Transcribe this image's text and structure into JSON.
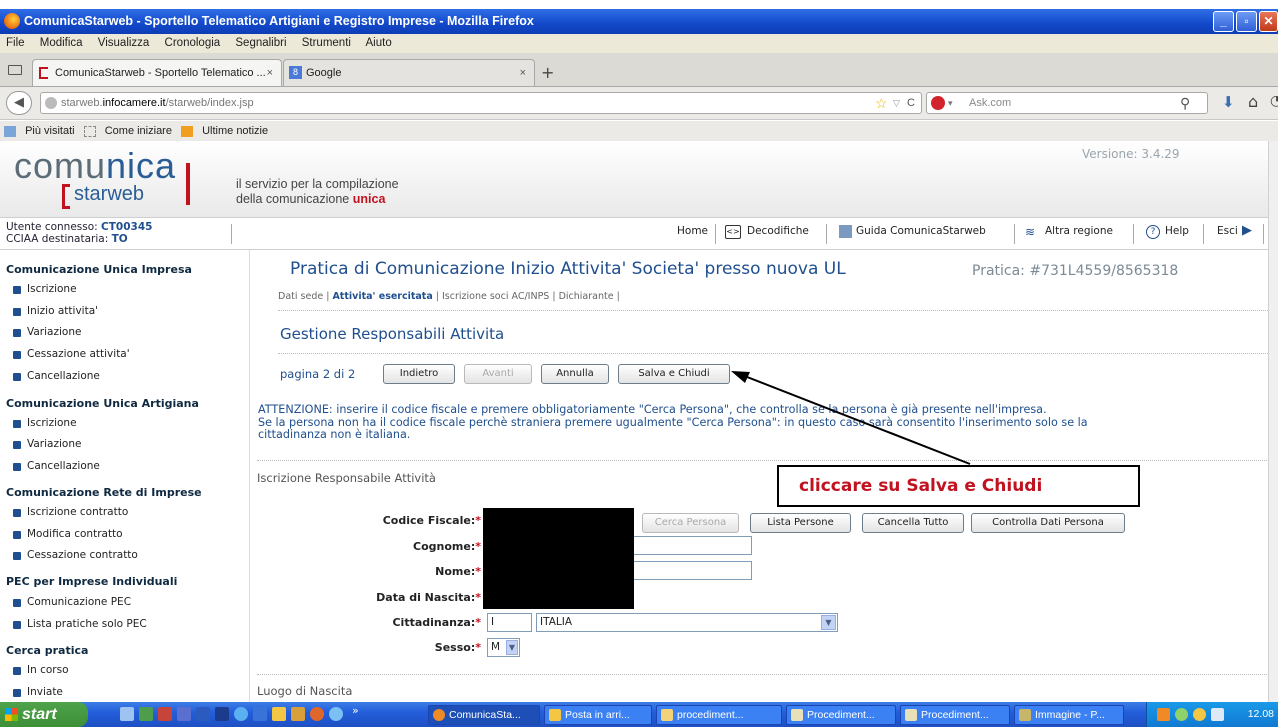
{
  "window": {
    "title": "ComunicaStarweb - Sportello Telematico Artigiani e Registro Imprese - Mozilla Firefox"
  },
  "menu": [
    "File",
    "Modifica",
    "Visualizza",
    "Cronologia",
    "Segnalibri",
    "Strumenti",
    "Aiuto"
  ],
  "tabs": [
    {
      "label": "ComunicaStarweb - Sportello Telematico ...",
      "active": true
    },
    {
      "label": "Google",
      "active": false
    }
  ],
  "browser": {
    "url_gray": "starweb.",
    "url_dark": "infocamere.it",
    "url_rest": "/starweb/index.jsp",
    "search_placeholder": "Ask.com"
  },
  "bookmarks": [
    "Più visitati",
    "Come iniziare",
    "Ultime notizie"
  ],
  "site": {
    "logo_a": "comu",
    "logo_b": "nica",
    "logo_sub": "starweb",
    "tagline_1": "il servizio per la compilazione",
    "tagline_2a": "della comunicazione ",
    "tagline_2b": "unica",
    "version": "Versione: 3.4.29"
  },
  "user": {
    "label_user": "Utente connesso: ",
    "user": "CT00345",
    "label_cciaa": "CCIAA destinataria: ",
    "cciaa": "TO"
  },
  "topnav": [
    "Home",
    "Decodifiche",
    "Guida ComunicaStarweb",
    "Altra regione",
    "Help",
    "Esci"
  ],
  "sidebar": {
    "sections": [
      {
        "title": "Comunicazione Unica Impresa",
        "items": [
          "Iscrizione",
          "Inizio attivita'",
          "Variazione",
          "Cessazione attivita'",
          "Cancellazione"
        ]
      },
      {
        "title": "Comunicazione Unica Artigiana",
        "items": [
          "Iscrizione",
          "Variazione",
          "Cancellazione"
        ]
      },
      {
        "title": "Comunicazione Rete di Imprese",
        "items": [
          "Iscrizione contratto",
          "Modifica contratto",
          "Cessazione contratto"
        ]
      },
      {
        "title": "PEC per Imprese Individuali",
        "items": [
          "Comunicazione PEC",
          "Lista pratiche solo PEC"
        ]
      },
      {
        "title": "Cerca pratica",
        "items": [
          "In corso",
          "Inviate"
        ]
      }
    ]
  },
  "main": {
    "title": "Pratica di Comunicazione Inizio Attivita' Societa' presso nuova UL",
    "pratica": "Pratica: #731L4559/8565318",
    "crumbs": {
      "a": "Dati sede | ",
      "b": "Attivita' esercitata",
      "c": " | Iscrizione soci AC/INPS | Dichiarante |"
    },
    "subtitle": "Gestione Responsabili Attivita",
    "page_label": "pagina 2 di 2",
    "buttons": {
      "indietro": "Indietro",
      "avanti": "Avanti",
      "annulla": "Annulla",
      "salva": "Salva e Chiudi"
    },
    "warning_1": "ATTENZIONE: inserire il codice fiscale e premere obbligatoriamente \"Cerca Persona\", che controlla se la persona è già presente nell'impresa.",
    "warning_2": "Se la persona non ha il codice fiscale perchè straniera premere ugualmente \"Cerca Persona\": in questo caso sarà consentito l'inserimento solo se la",
    "warning_3": "cittadinanza non è italiana.",
    "section_1": "Iscrizione Responsabile Attività",
    "form": {
      "codice_fiscale": "Codice Fiscale:",
      "cognome": "Cognome:",
      "nome": "Nome:",
      "data_nascita": "Data di Nascita:",
      "cittadinanza": "Cittadinanza:",
      "cittadinanza_code": "I",
      "cittadinanza_value": "ITALIA",
      "sesso": "Sesso:",
      "sesso_value": "M"
    },
    "person_buttons": {
      "cerca": "Cerca Persona",
      "lista": "Lista Persone",
      "cancella": "Cancella Tutto",
      "controlla": "Controlla Dati Persona"
    },
    "callout": "cliccare su Salva e Chiudi",
    "section_2": "Luogo di Nascita"
  },
  "taskbar": {
    "start": "start",
    "tasks": [
      "ComunicaSta...",
      "Posta in arri...",
      "procediment...",
      "Procediment...",
      "Procediment...",
      "Immagine - P..."
    ],
    "clock": "12.08"
  },
  "colors": {
    "title_blue": "#1f4f8e",
    "accent_red": "#c1121f",
    "taskbar_blue": "#245edb"
  }
}
